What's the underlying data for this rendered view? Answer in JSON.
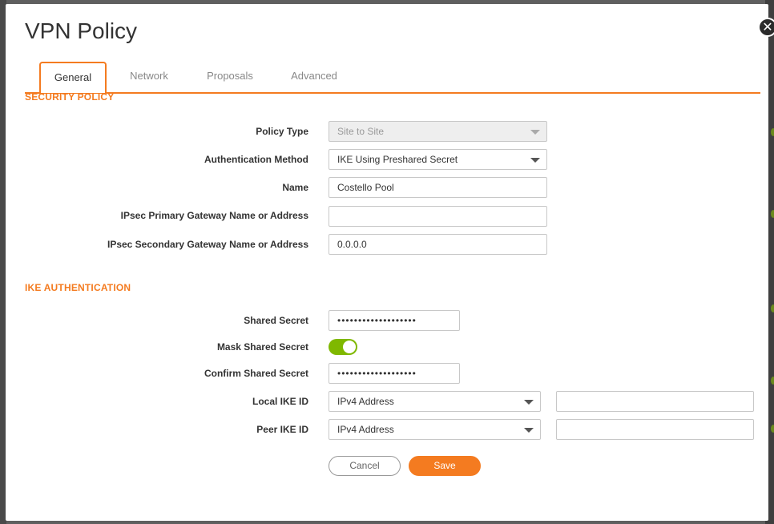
{
  "dialog": {
    "title": "VPN Policy",
    "close_glyph": "✕",
    "accent_color": "#f47b20",
    "toggle_color": "#7fb800"
  },
  "tabs": [
    {
      "label": "General",
      "active": true
    },
    {
      "label": "Network",
      "active": false
    },
    {
      "label": "Proposals",
      "active": false
    },
    {
      "label": "Advanced",
      "active": false
    }
  ],
  "security_policy": {
    "heading": "SECURITY POLICY",
    "policy_type": {
      "label": "Policy Type",
      "value": "Site to Site",
      "disabled": true
    },
    "auth_method": {
      "label": "Authentication Method",
      "value": "IKE Using Preshared Secret"
    },
    "name": {
      "label": "Name",
      "value": "Costello Pool"
    },
    "primary_gateway": {
      "label": "IPsec Primary Gateway Name or Address",
      "value": ""
    },
    "secondary_gateway": {
      "label": "IPsec Secondary Gateway Name or Address",
      "value": "0.0.0.0"
    }
  },
  "ike_auth": {
    "heading": "IKE AUTHENTICATION",
    "shared_secret": {
      "label": "Shared Secret",
      "value": "•••••••••••••••••••"
    },
    "mask_shared_secret": {
      "label": "Mask Shared Secret",
      "on": true
    },
    "confirm_shared_secret": {
      "label": "Confirm Shared Secret",
      "value": "•••••••••••••••••••"
    },
    "local_ike_id": {
      "label": "Local IKE ID",
      "type": "IPv4 Address",
      "value": ""
    },
    "peer_ike_id": {
      "label": "Peer IKE ID",
      "type": "IPv4 Address",
      "value": ""
    }
  },
  "actions": {
    "cancel_label": "Cancel",
    "save_label": "Save"
  }
}
